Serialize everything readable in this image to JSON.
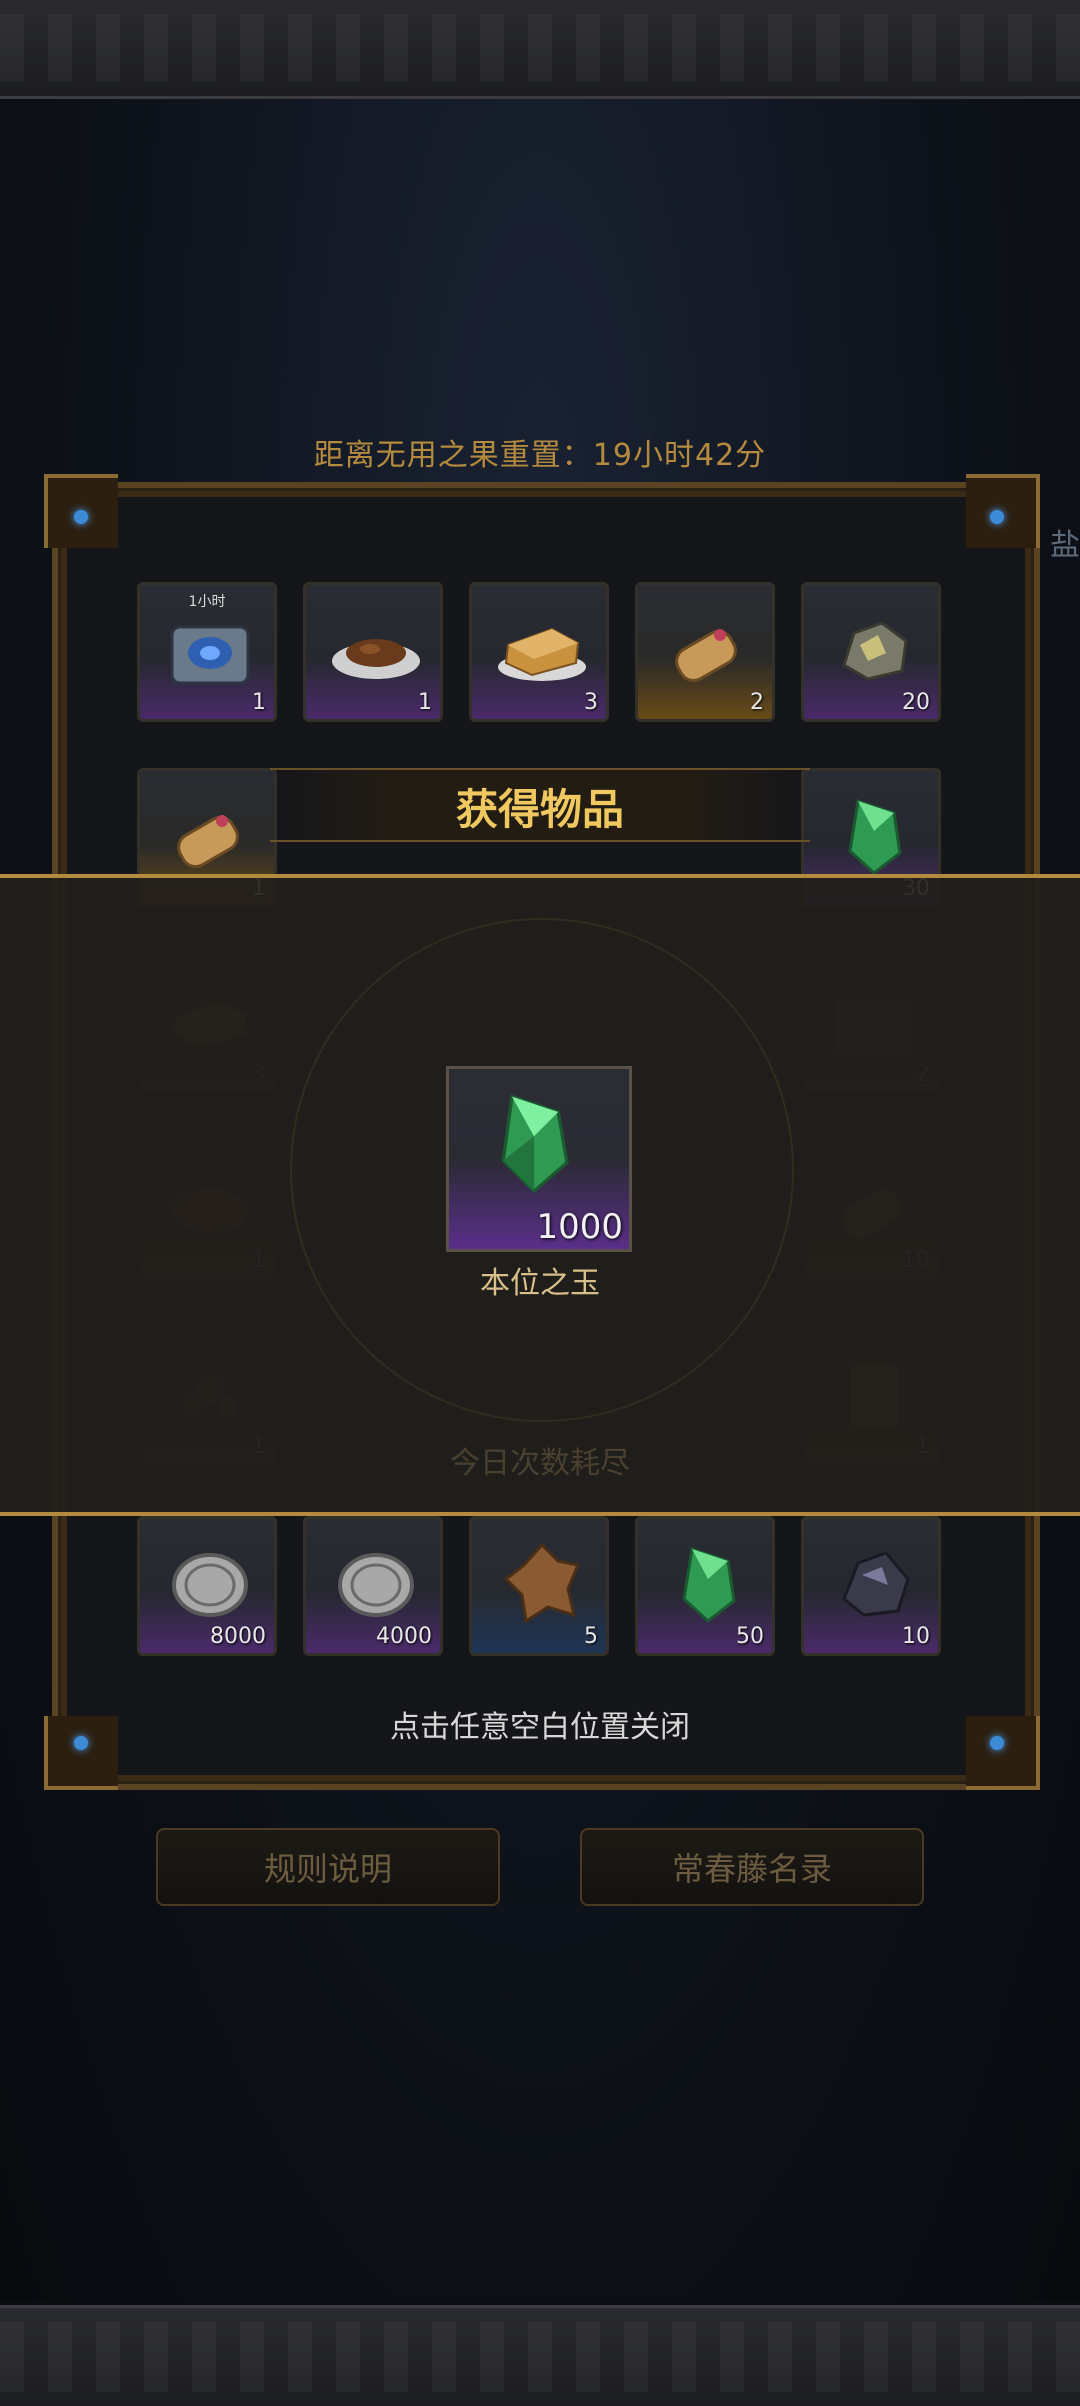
{
  "header": {
    "reset_timer": "距离无用之果重置：19小时42分",
    "side_char": "盐"
  },
  "grid_rows": {
    "row1": [
      {
        "icon": "chest-icon",
        "tag": "1小时",
        "count": "1",
        "rarity": "purple"
      },
      {
        "icon": "dish-icon",
        "count": "1",
        "rarity": "purple"
      },
      {
        "icon": "bread-icon",
        "count": "3",
        "rarity": "purple"
      },
      {
        "icon": "scroll-icon",
        "count": "2",
        "rarity": "gold"
      },
      {
        "icon": "ore-icon",
        "count": "20",
        "rarity": "purple"
      }
    ],
    "row2": [
      {
        "icon": "scroll-icon",
        "count": "1",
        "rarity": "gold"
      },
      {
        "icon": "green-gem-icon",
        "count": "30",
        "rarity": "purple"
      }
    ],
    "row3": [
      {
        "icon": "bread-icon",
        "count": "3",
        "rarity": "purple"
      },
      {
        "icon": "chest-icon",
        "count": "2",
        "rarity": "purple"
      }
    ],
    "row4": [
      {
        "icon": "bread-icon",
        "count": "1",
        "rarity": "gold"
      },
      {
        "icon": "scroll-icon",
        "count": "10",
        "rarity": "gold"
      }
    ],
    "row5": [
      {
        "icon": "flower-icon",
        "count": "1",
        "rarity": "purple"
      },
      {
        "icon": "barrel-icon",
        "count": "1",
        "rarity": "gold"
      }
    ],
    "row6": [
      {
        "icon": "silver-coin-icon",
        "count": "8000",
        "rarity": "purple"
      },
      {
        "icon": "silver-coin-icon",
        "count": "4000",
        "rarity": "purple"
      },
      {
        "icon": "leather-icon",
        "count": "5",
        "rarity": "blue"
      },
      {
        "icon": "green-gem-icon",
        "count": "50",
        "rarity": "purple"
      },
      {
        "icon": "dark-ore-icon",
        "count": "10",
        "rarity": "purple"
      }
    ]
  },
  "hidden_caption": "今日次数耗尽",
  "popup": {
    "title": "获得物品",
    "reward": {
      "icon": "green-gem-icon",
      "count": "1000",
      "name": "本位之玉"
    },
    "close_hint": "点击任意空白位置关闭"
  },
  "buttons": {
    "rules": "规则说明",
    "hall": "常春藤名录"
  },
  "colors": {
    "accent_gold": "#f0c860",
    "frame_brown": "#5a4322",
    "rarity_purple": "#5a2f8a"
  }
}
